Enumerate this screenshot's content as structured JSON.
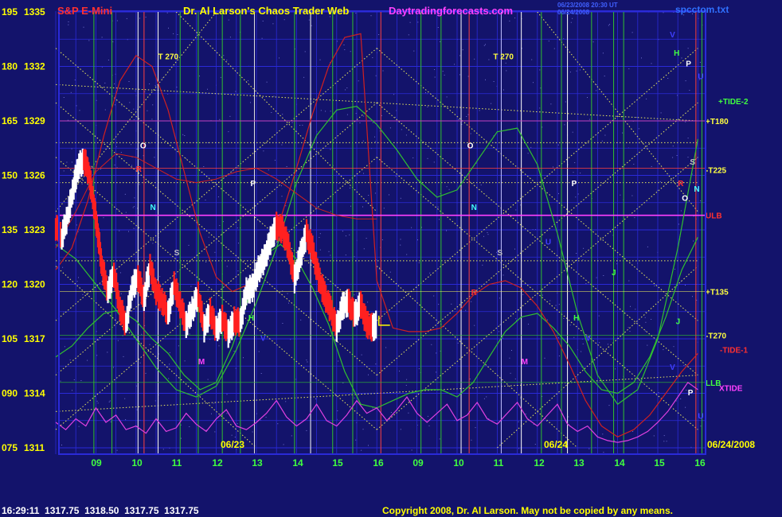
{
  "header": {
    "instrument": "S&P E-Mini",
    "title": "Dr. Al Larson's Chaos Trader Web",
    "site": "Daytradingforecasts.com",
    "file": "spcctom.txt",
    "timestamp_line1": "06/23/2008 20:30 UT",
    "timestamp_line2": "06/24/2008"
  },
  "footer": {
    "quote": "16:29:11  1317.75  1318.50  1317.75  1317.75",
    "copyright": "Copyright 2008, Dr. Al Larson. May not be copied by any means."
  },
  "colors": {
    "background": "#13136b",
    "grid": "#2a2ad8",
    "price_up": "#ffffff",
    "price_down": "#ff2020",
    "green_flux": "#30c030",
    "red_flux": "#d02020",
    "magenta_flux": "#e040e0",
    "yellow_dotted": "#e8e860",
    "title_yellow": "#ffff00",
    "site_magenta": "#ff40ff",
    "instrument_red": "#ff3030"
  },
  "chart_data": {
    "type": "line",
    "title": "Dr. Al Larson's Chaos Trader Web",
    "ylim": [
      1311,
      1335
    ],
    "y_left_labels": [
      {
        "code": "195",
        "price": "1335",
        "value": 1335
      },
      {
        "code": "180",
        "price": "1332",
        "value": 1332
      },
      {
        "code": "165",
        "price": "1329",
        "value": 1329
      },
      {
        "code": "150",
        "price": "1326",
        "value": 1326
      },
      {
        "code": "135",
        "price": "1323",
        "value": 1323
      },
      {
        "code": "120",
        "price": "1320",
        "value": 1320
      },
      {
        "code": "105",
        "price": "1317",
        "value": 1317
      },
      {
        "code": "090",
        "price": "1314",
        "value": 1314
      },
      {
        "code": "075",
        "price": "1311",
        "value": 1311
      }
    ],
    "x_hours": [
      "09",
      "10",
      "11",
      "12",
      "13",
      "14",
      "15",
      "16",
      "09",
      "10",
      "11",
      "12",
      "13",
      "14",
      "15",
      "16"
    ],
    "day_labels": [
      "06/23",
      "06/24",
      "06/24/2008"
    ],
    "right_labels": [
      {
        "text": "+T180",
        "value": 1329,
        "color": "#ffff40"
      },
      {
        "text": "-T225",
        "value": 1326.3,
        "color": "#ffff40"
      },
      {
        "text": "ULB",
        "value": 1323.8,
        "color": "#ff3030"
      },
      {
        "text": "+T135",
        "value": 1319.6,
        "color": "#ffff40"
      },
      {
        "text": "-T270",
        "value": 1317.2,
        "color": "#ffff40"
      },
      {
        "text": "-TIDE-1",
        "value": 1316.4,
        "color": "#ff3030"
      },
      {
        "text": "LLB",
        "value": 1314.6,
        "color": "#40ff40"
      },
      {
        "text": "XTIDE",
        "value": 1314.3,
        "color": "#ff40ff"
      },
      {
        "text": "+TIDE-2",
        "value": 1330.1,
        "color": "#40ff40"
      }
    ],
    "planet_marks": [
      {
        "text": "V",
        "t": 15.3,
        "v": 1333.6,
        "color": "#4040ff"
      },
      {
        "text": "H",
        "t": 15.4,
        "v": 1332.6,
        "color": "#40ff40"
      },
      {
        "text": "P",
        "t": 15.7,
        "v": 1332.0,
        "color": "#ffffff"
      },
      {
        "text": "U",
        "t": 16.0,
        "v": 1331.3,
        "color": "#4040ff"
      },
      {
        "text": "S",
        "t": 15.8,
        "v": 1326.6,
        "color": "#c0c0c0"
      },
      {
        "text": "R",
        "t": 15.5,
        "v": 1325.4,
        "color": "#ff3030"
      },
      {
        "text": "N",
        "t": 15.9,
        "v": 1325.1,
        "color": "#40ffff"
      },
      {
        "text": "O",
        "t": 15.6,
        "v": 1324.6,
        "color": "#ffffff"
      },
      {
        "text": "J",
        "t": 15.45,
        "v": 1317.8,
        "color": "#40ff40"
      },
      {
        "text": "V",
        "t": 15.3,
        "v": 1315.3,
        "color": "#4040ff"
      },
      {
        "text": "P",
        "t": 15.75,
        "v": 1313.9,
        "color": "#ffffff"
      },
      {
        "text": "U",
        "t": 16.0,
        "v": 1312.6,
        "color": "#4040ff"
      },
      {
        "text": "T 270",
        "t": 2.55,
        "v": 1332.4,
        "color": "#ffff40"
      },
      {
        "text": "T 270",
        "t": 10.9,
        "v": 1332.4,
        "color": "#ffff40"
      },
      {
        "text": "O",
        "t": 2.1,
        "v": 1327.5,
        "color": "#ffffff"
      },
      {
        "text": "O",
        "t": 10.25,
        "v": 1327.5,
        "color": "#ffffff"
      },
      {
        "text": "N",
        "t": 2.35,
        "v": 1324.1,
        "color": "#40ffff"
      },
      {
        "text": "N",
        "t": 10.35,
        "v": 1324.1,
        "color": "#40ffff"
      },
      {
        "text": "S",
        "t": 2.95,
        "v": 1321.6,
        "color": "#c0c0c0"
      },
      {
        "text": "S",
        "t": 11.0,
        "v": 1321.6,
        "color": "#c0c0c0"
      },
      {
        "text": "P",
        "t": 4.85,
        "v": 1325.4,
        "color": "#ffffff"
      },
      {
        "text": "P",
        "t": 12.85,
        "v": 1325.4,
        "color": "#ffffff"
      },
      {
        "text": "H",
        "t": 4.8,
        "v": 1318.0,
        "color": "#40ff40"
      },
      {
        "text": "H",
        "t": 12.9,
        "v": 1318.0,
        "color": "#40ff40"
      },
      {
        "text": "V",
        "t": 5.1,
        "v": 1316.9,
        "color": "#4040ff"
      },
      {
        "text": "V",
        "t": 13.2,
        "v": 1316.9,
        "color": "#4040ff"
      },
      {
        "text": "M",
        "t": 3.55,
        "v": 1315.6,
        "color": "#ff40ff"
      },
      {
        "text": "M",
        "t": 11.6,
        "v": 1315.6,
        "color": "#ff40ff"
      },
      {
        "text": "R",
        "t": 10.35,
        "v": 1319.4,
        "color": "#ff3030"
      },
      {
        "text": "U",
        "t": 12.2,
        "v": 1322.2,
        "color": "#4040ff"
      },
      {
        "text": "J",
        "t": 13.85,
        "v": 1320.5,
        "color": "#40ff40"
      },
      {
        "text": "R",
        "t": 2.0,
        "v": 1326.2,
        "color": "#ff3030"
      }
    ],
    "price_series": {
      "name": "S&P E-Mini",
      "t": [
        0.0,
        0.15,
        0.3,
        0.45,
        0.55,
        0.7,
        0.82,
        0.95,
        1.05,
        1.15,
        1.3,
        1.45,
        1.6,
        1.75,
        1.9,
        2.05,
        2.2,
        2.35,
        2.5,
        2.65,
        2.8,
        2.95,
        3.1,
        3.25,
        3.4,
        3.55,
        3.7,
        3.85,
        4.0,
        4.15,
        4.3,
        4.45,
        4.6,
        4.75,
        4.9,
        5.05,
        5.2,
        5.35,
        5.5,
        5.65,
        5.8,
        5.95,
        6.1,
        6.25,
        6.4,
        6.55,
        6.7,
        6.85,
        7.0,
        7.15,
        7.3,
        7.45,
        7.6,
        7.75,
        7.9,
        8.0
      ],
      "v": [
        1323.2,
        1322.6,
        1323.8,
        1325.4,
        1326.4,
        1326.9,
        1326.2,
        1324.4,
        1322.8,
        1321.0,
        1319.6,
        1320.6,
        1318.7,
        1317.8,
        1319.8,
        1320.4,
        1319.2,
        1321.0,
        1319.6,
        1319.1,
        1318.4,
        1320.0,
        1318.9,
        1317.8,
        1318.6,
        1319.4,
        1317.6,
        1318.5,
        1317.5,
        1318.1,
        1317.3,
        1318.0,
        1317.9,
        1319.6,
        1319.8,
        1320.8,
        1321.4,
        1322.4,
        1323.2,
        1323.0,
        1322.0,
        1320.3,
        1321.6,
        1322.8,
        1321.9,
        1320.4,
        1319.4,
        1318.6,
        1317.6,
        1318.8,
        1319.0,
        1318.3,
        1318.9,
        1317.8,
        1317.6,
        1317.8
      ]
    },
    "green_flux": {
      "name": "green flux",
      "t": [
        0.0,
        0.4,
        0.8,
        1.2,
        1.6,
        2.0,
        2.4,
        2.8,
        3.2,
        3.6,
        4.0,
        4.4,
        4.8,
        5.2,
        5.6,
        6.0,
        6.4,
        6.8,
        7.2,
        7.6,
        8.0,
        8.4,
        8.8,
        9.2,
        9.6,
        10.0,
        10.4,
        10.8,
        11.2,
        11.6,
        12.0,
        12.4,
        12.8,
        13.2,
        13.6,
        14.0,
        14.4,
        14.8,
        15.2,
        15.6,
        16.0
      ],
      "v": [
        1316.0,
        1316.6,
        1317.6,
        1318.4,
        1318.6,
        1318.0,
        1317.0,
        1316.2,
        1315.0,
        1314.2,
        1314.6,
        1316.6,
        1319.2,
        1321.6,
        1322.2,
        1321.4,
        1319.8,
        1317.8,
        1315.2,
        1313.4,
        1313.2,
        1313.6,
        1314.0,
        1314.2,
        1314.2,
        1313.8,
        1314.6,
        1316.0,
        1317.4,
        1318.2,
        1318.4,
        1317.6,
        1316.6,
        1315.2,
        1314.2,
        1314.0,
        1314.6,
        1316.0,
        1318.2,
        1320.8,
        1322.6
      ]
    },
    "green_flux_2": {
      "name": "green flux 2",
      "t": [
        0.0,
        0.5,
        1.0,
        1.5,
        2.0,
        2.5,
        3.0,
        3.5,
        4.0,
        4.5,
        5.0,
        5.5,
        6.0,
        6.5,
        7.0,
        7.5,
        8.0,
        8.5,
        9.0,
        9.5,
        10.0,
        10.5,
        11.0,
        11.5,
        12.0,
        12.5,
        13.0,
        13.5,
        14.0,
        14.5,
        15.0,
        15.5,
        16.0
      ],
      "v": [
        1322.2,
        1321.4,
        1320.0,
        1318.6,
        1317.0,
        1315.4,
        1314.2,
        1313.8,
        1314.4,
        1316.4,
        1319.0,
        1322.0,
        1325.6,
        1328.2,
        1329.6,
        1329.8,
        1328.8,
        1327.4,
        1325.8,
        1324.8,
        1325.2,
        1326.8,
        1328.4,
        1328.6,
        1326.6,
        1322.8,
        1318.4,
        1315.0,
        1313.4,
        1314.2,
        1317.0,
        1322.0,
        1328.0
      ]
    },
    "red_flux": {
      "name": "red flux",
      "t": [
        0.0,
        0.4,
        0.8,
        1.2,
        1.6,
        2.0,
        2.4,
        2.8,
        3.2,
        3.6,
        4.0,
        4.4,
        4.8,
        5.2,
        5.6,
        6.0,
        6.4,
        6.8,
        7.2,
        7.6,
        8.0,
        8.4,
        8.8,
        9.2,
        9.6,
        10.0,
        10.4,
        10.8,
        11.2,
        11.6,
        12.0,
        12.4,
        12.8,
        13.2,
        13.6,
        14.0,
        14.4,
        14.8,
        15.2,
        15.6,
        16.0
      ],
      "v": [
        1320.8,
        1322.0,
        1324.6,
        1328.2,
        1331.2,
        1332.6,
        1332.0,
        1329.6,
        1326.2,
        1322.8,
        1320.4,
        1319.6,
        1320.0,
        1321.4,
        1323.6,
        1326.4,
        1329.4,
        1332.0,
        1333.6,
        1333.8,
        1320.2,
        1317.6,
        1317.4,
        1317.4,
        1317.6,
        1318.4,
        1319.4,
        1320.0,
        1320.2,
        1319.8,
        1318.8,
        1317.4,
        1315.6,
        1313.6,
        1312.2,
        1311.6,
        1312.0,
        1312.8,
        1314.0,
        1315.2,
        1316.2
      ]
    },
    "red_flux_2": {
      "name": "red flux 2",
      "t": [
        0.0,
        0.5,
        1.0,
        1.5,
        2.0,
        2.5,
        3.0,
        3.5,
        4.0,
        4.5,
        5.0,
        5.5,
        6.0,
        6.5,
        7.0,
        7.5,
        8.0
      ],
      "v": [
        1322.0,
        1324.0,
        1326.2,
        1327.2,
        1327.0,
        1326.4,
        1325.8,
        1325.6,
        1325.8,
        1326.2,
        1326.4,
        1325.8,
        1325.0,
        1324.2,
        1323.8,
        1323.6,
        1323.6
      ]
    },
    "magenta_flux": {
      "name": "magenta flux",
      "t": [
        0.0,
        0.25,
        0.5,
        0.75,
        1.0,
        1.25,
        1.5,
        1.75,
        2.0,
        2.25,
        2.5,
        2.75,
        3.0,
        3.25,
        3.5,
        3.75,
        4.0,
        4.25,
        4.5,
        4.75,
        5.0,
        5.25,
        5.5,
        5.75,
        6.0,
        6.25,
        6.5,
        6.75,
        7.0,
        7.25,
        7.5,
        7.75,
        8.0,
        8.25,
        8.5,
        8.75,
        9.0,
        9.25,
        9.5,
        9.75,
        10.0,
        10.25,
        10.5,
        10.75,
        11.0,
        11.25,
        11.5,
        11.75,
        12.0,
        12.25,
        12.5,
        12.75,
        13.0,
        13.25,
        13.5,
        13.75,
        14.0,
        14.25,
        14.5,
        14.75,
        15.0,
        15.25,
        15.5,
        15.75,
        16.0
      ],
      "v": [
        1312.4,
        1312.0,
        1312.6,
        1312.2,
        1313.2,
        1312.4,
        1312.8,
        1312.0,
        1312.2,
        1311.8,
        1312.6,
        1311.9,
        1312.1,
        1312.9,
        1312.3,
        1311.9,
        1312.6,
        1313.1,
        1312.2,
        1312.0,
        1312.4,
        1312.9,
        1313.6,
        1312.7,
        1312.2,
        1312.6,
        1313.4,
        1312.5,
        1312.2,
        1312.8,
        1313.6,
        1312.9,
        1313.2,
        1312.5,
        1313.1,
        1313.8,
        1312.9,
        1312.4,
        1312.9,
        1313.4,
        1312.5,
        1312.8,
        1313.5,
        1312.6,
        1312.3,
        1312.9,
        1313.5,
        1312.6,
        1312.2,
        1312.8,
        1313.4,
        1312.3,
        1311.9,
        1312.2,
        1311.6,
        1311.4,
        1311.3,
        1311.4,
        1311.6,
        1311.9,
        1312.4,
        1313.0,
        1313.8,
        1314.6,
        1314.2
      ]
    }
  }
}
